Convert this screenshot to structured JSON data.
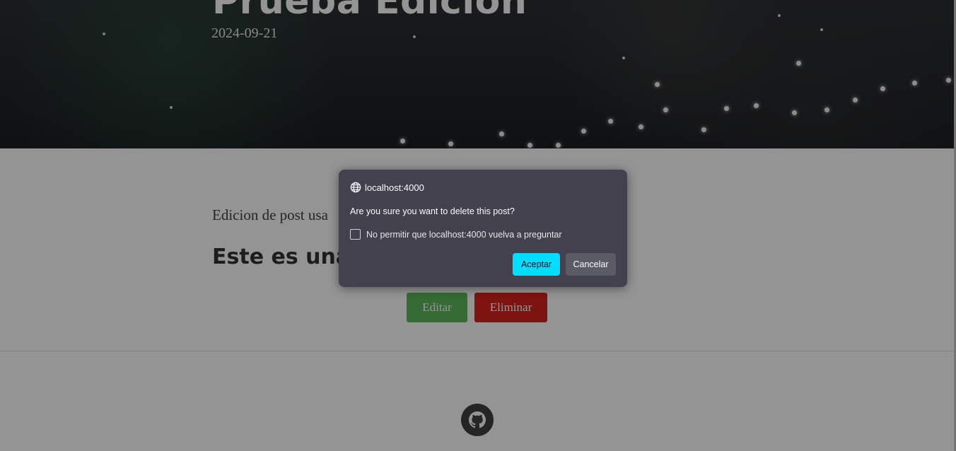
{
  "page": {
    "title": "Prueba Edicion",
    "date": "2024-09-21",
    "excerpt": "Edicion de post usa",
    "subheading": "Este es una",
    "edit_label": "Editar",
    "delete_label": "Eliminar",
    "footer_icon": "github-icon"
  },
  "dialog": {
    "origin": "localhost:4000",
    "origin_icon": "globe-icon",
    "message": "Are you sure you want to delete this post?",
    "checkbox_label": "No permitir que localhost:4000 vuelva a preguntar",
    "checkbox_checked": false,
    "accept_label": "Aceptar",
    "cancel_label": "Cancelar"
  },
  "colors": {
    "accept": "#00ddff",
    "dialog_bg": "#42414d",
    "edit_button": "#5cb85c",
    "delete_button": "#d9231e"
  }
}
